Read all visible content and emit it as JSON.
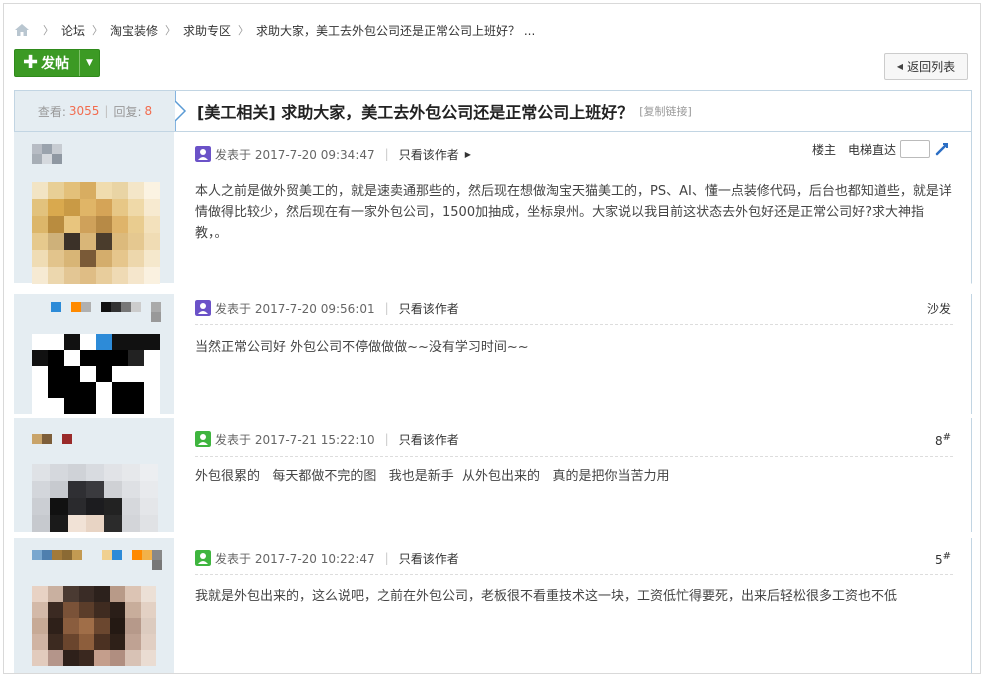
{
  "breadcrumb": {
    "items": [
      "论坛",
      "淘宝装修",
      "求助专区",
      "求助大家，美工去外包公司还是正常公司上班好？ ..."
    ]
  },
  "toolbar": {
    "post_label": "发帖",
    "back_label": "返回列表"
  },
  "thread": {
    "views_label": "查看:",
    "views": "3055",
    "replies_label": "回复:",
    "replies": "8",
    "title": "[美工相关] 求助大家，美工去外包公司还是正常公司上班好？",
    "copy_link": "[复制链接]"
  },
  "posts": [
    {
      "date": "发表于 2017-7-20 09:34:47",
      "only_author": "只看该作者",
      "floor_label": "楼主",
      "jump_label": "电梯直达",
      "content": "本人之前是做外贸美工的，就是速卖通那些的，然后现在想做淘宝天猫美工的，PS、AI、懂一点装修代码，后台也都知道些，就是详情做得比较少，然后现在有一家外包公司，1500加抽成，坐标泉州。大家说以我目前这状态去外包好还是正常公司好?求大神指教，。"
    },
    {
      "date": "发表于 2017-7-20 09:56:01",
      "only_author": "只看该作者",
      "floor_label": "沙发",
      "content": "当然正常公司好 外包公司不停做做做~~没有学习时间~~"
    },
    {
      "date": "发表于 2017-7-21 15:22:10",
      "only_author": "只看该作者",
      "floor_label": "8",
      "floor_sup": "#",
      "content": "外包很累的   每天都做不完的图   我也是新手  从外包出来的   真的是把你当苦力用"
    },
    {
      "date": "发表于 2017-7-20 10:22:47",
      "only_author": "只看该作者",
      "floor_label": "5",
      "floor_sup": "#",
      "content": "我就是外包出来的，这么说吧，之前在外包公司，老板很不看重技术这一块，工资低忙得要死，出来后轻松很多工资也不低"
    }
  ],
  "colors": {
    "accent_green": "#3c9a24",
    "stat_number": "#f26c4f",
    "side_bg": "#e5edf2",
    "border": "#c2d5e3"
  },
  "icons": [
    "home-icon",
    "plus-icon",
    "dropdown-arrow-icon",
    "back-arrow-icon",
    "print-icon",
    "prev-thread-icon",
    "next-thread-icon",
    "user-icon",
    "play-icon",
    "jump-go-icon"
  ]
}
